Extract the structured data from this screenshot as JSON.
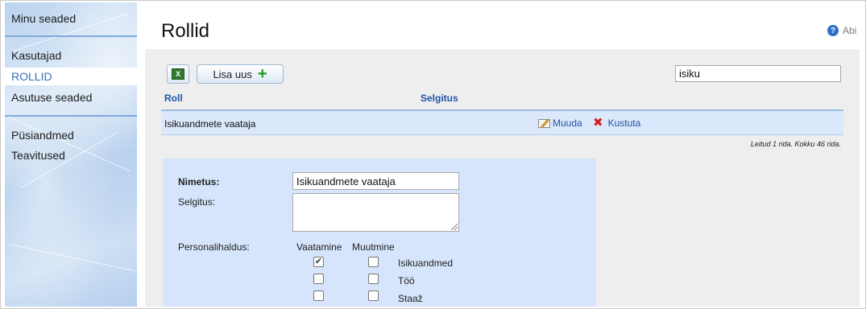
{
  "sidebar": {
    "items": [
      {
        "label": "Minu seaded",
        "active": false
      },
      {
        "label": "Kasutajad",
        "active": false
      },
      {
        "label": "ROLLID",
        "active": true
      },
      {
        "label": "Asutuse seaded",
        "active": false
      },
      {
        "label": "Püsiandmed",
        "active": false
      },
      {
        "label": "Teavitused",
        "active": false
      }
    ]
  },
  "header": {
    "title": "Rollid",
    "help_label": "Abi",
    "help_icon": "?"
  },
  "toolbar": {
    "excel_icon": "excel-icon",
    "excel_glyph": "X",
    "add_label": "Lisa uus",
    "add_plus": "+",
    "search_value": "isiku"
  },
  "table": {
    "columns": [
      "Roll",
      "Selgitus"
    ],
    "rows": [
      {
        "name": "Isikuandmete vaataja",
        "description": "",
        "edit_label": "Muuda",
        "delete_label": "Kustuta"
      }
    ],
    "footer": "Leitud 1 rida. Kokku 46 rida."
  },
  "form": {
    "name_label": "Nimetus:",
    "name_value": "Isikuandmete vaataja",
    "description_label": "Selgitus:",
    "description_value": "",
    "section_label": "Personalihaldus:",
    "col_view": "Vaatamine",
    "col_edit": "Muutmine",
    "permissions": [
      {
        "label": "Isikuandmed",
        "view": true,
        "edit": false
      },
      {
        "label": "Töö",
        "view": false,
        "edit": false
      },
      {
        "label": "Staaž",
        "view": false,
        "edit": false
      }
    ],
    "check_glyph": "✔"
  },
  "colors": {
    "accent_blue": "#2153a4",
    "active_nav": "#3a6fb8",
    "row_bg": "#dbe8fb",
    "form_bg": "#d6e5fb",
    "add_icon": "#1e9a1e",
    "delete_icon": "#d42020"
  }
}
